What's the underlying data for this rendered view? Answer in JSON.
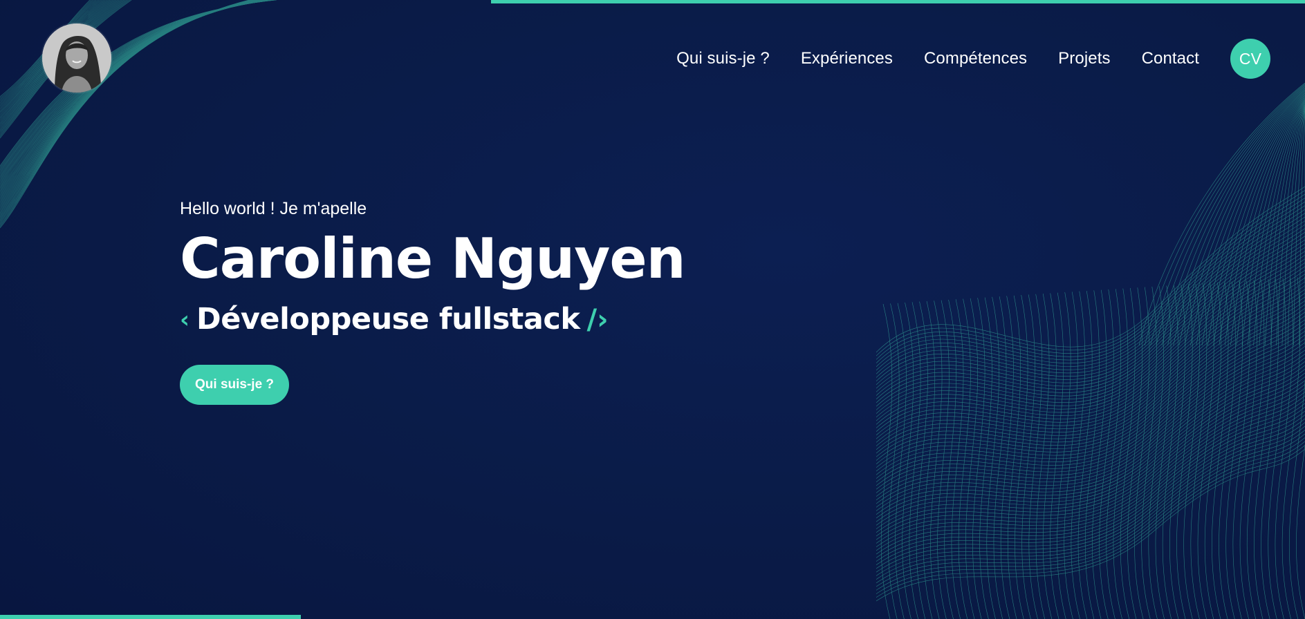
{
  "nav": {
    "items": [
      {
        "label": "Qui suis-je ?"
      },
      {
        "label": "Expériences"
      },
      {
        "label": "Compétences"
      },
      {
        "label": "Projets"
      },
      {
        "label": "Contact"
      }
    ],
    "cv_label": "CV"
  },
  "hero": {
    "greeting": "Hello world ! Je m'apelle",
    "name": "Caroline Nguyen",
    "role_open": "‹",
    "role": "Développeuse fullstack",
    "role_close": "/›",
    "cta_label": "Qui suis-je ?"
  },
  "icons": {
    "avatar": "profile-photo",
    "background": "wave-mesh"
  },
  "colors": {
    "background": "#0a1b47",
    "accent": "#3ecfae",
    "text": "#ffffff"
  }
}
